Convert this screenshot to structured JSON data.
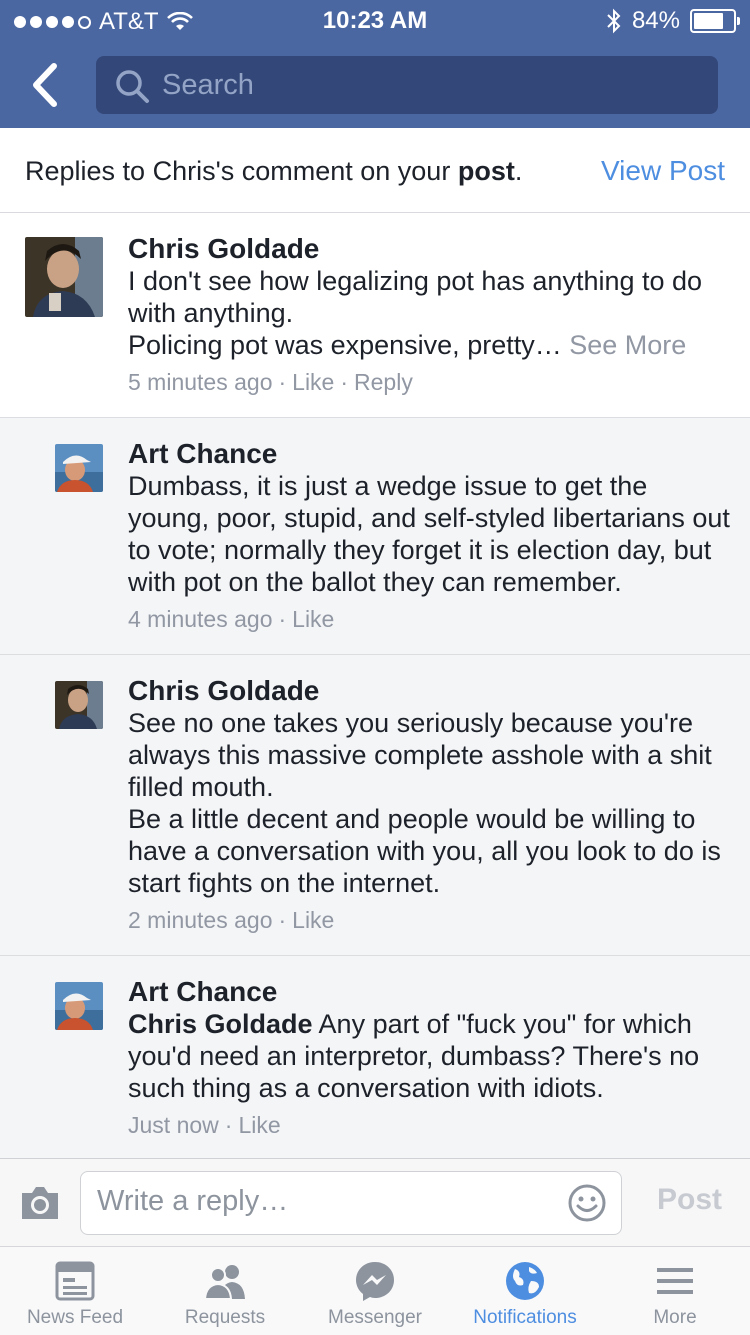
{
  "status": {
    "carrier": "AT&T",
    "time": "10:23 AM",
    "battery": "84%",
    "battery_level": 0.84,
    "signal_bars_filled": 4
  },
  "nav": {
    "search_placeholder": "Search"
  },
  "header": {
    "text_prefix": "Replies to Chris's comment on your ",
    "text_bold": "post",
    "text_suffix": ".",
    "view_post": "View Post"
  },
  "comments": [
    {
      "author": "Chris Goldade",
      "lines": [
        "I don't see how legalizing pot has anything to do with anything.",
        "Policing pot was expensive, pretty…"
      ],
      "see_more": "See More",
      "time": "5 minutes ago",
      "like": "Like",
      "reply": "Reply"
    },
    {
      "author": "Art Chance",
      "text": "Dumbass, it is just a wedge issue to get the young, poor, stupid, and self-styled libertarians out to vote; normally they forget it is election day, but with pot on the ballot they can remember.",
      "time": "4 minutes ago",
      "like": "Like"
    },
    {
      "author": "Chris Goldade",
      "lines": [
        "See no one takes you seriously because you're always this massive complete asshole with a shit filled mouth.",
        "Be a little decent and people would be willing to have a conversation with you, all you look to do is start fights on the internet."
      ],
      "time": "2 minutes ago",
      "like": "Like"
    },
    {
      "author": "Art Chance",
      "mention": "Chris Goldade",
      "text": " Any part of \"fuck you\" for which you'd need an interpretor, dumbass?   There's no such thing as a conversation with idiots.",
      "time": "Just now",
      "like": "Like"
    }
  ],
  "composer": {
    "placeholder": "Write a reply…",
    "post": "Post"
  },
  "tabs": [
    {
      "label": "News Feed",
      "icon": "news-feed-icon"
    },
    {
      "label": "Requests",
      "icon": "friend-requests-icon"
    },
    {
      "label": "Messenger",
      "icon": "messenger-icon"
    },
    {
      "label": "Notifications",
      "icon": "globe-icon",
      "active": true
    },
    {
      "label": "More",
      "icon": "menu-icon"
    }
  ],
  "colors": {
    "brand": "#4b67a2",
    "link": "#4e8ee0",
    "muted": "#9197a3"
  }
}
